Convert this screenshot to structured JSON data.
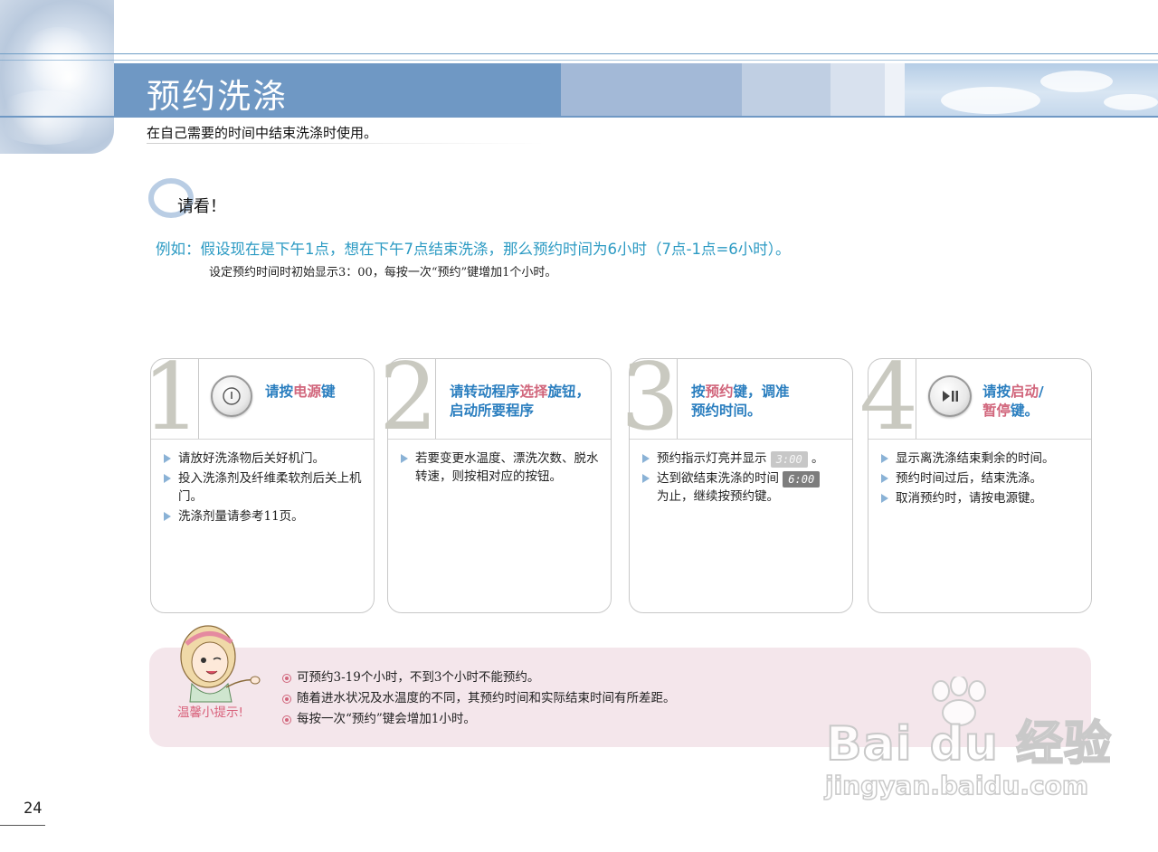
{
  "header": {
    "title": "预约洗涤",
    "subtitle": "在自己需要的时间中结束洗涤时使用。"
  },
  "note": {
    "title": "请看！",
    "example": "例如：假设现在是下午1点，想在下午7点结束洗涤，那么预约时间为6小时（7点-1点=6小时）。",
    "detail": "设定预约时间时初始显示3：00，每按一次“预约”键增加1个小时。"
  },
  "steps": [
    {
      "number": "1",
      "icon": "power-icon",
      "head": {
        "pre": "请按",
        "highlight": "电源",
        "post": "键"
      },
      "items": [
        "请放好洗涤物后关好机门。",
        "投入洗涤剂及纤维柔软剂后关上机门。",
        "洗涤剂量请参考11页。"
      ]
    },
    {
      "number": "2",
      "head": {
        "line1_pre": "请转动程序",
        "line1_highlight": "选择",
        "line1_post": "旋钮，",
        "line2": "启动所要程序"
      },
      "items": [
        "若要变更水温度、漂洗次数、脱水转速，则按相对应的按钮。"
      ]
    },
    {
      "number": "3",
      "head": {
        "line1_pre": "按",
        "line1_highlight": "预约",
        "line1_post": "键，调准",
        "line2": "预约时间。"
      },
      "items": [
        {
          "pre": "预约指示灯亮并显示",
          "lcd": "3:00",
          "post": "。"
        },
        {
          "pre": "达到欲结束洗涤的时间",
          "lcd": "6:00",
          "post": "为止，继续按预约键。"
        }
      ]
    },
    {
      "number": "4",
      "icon": "play-pause-icon",
      "head": {
        "line1_pre": "请按",
        "line1_highlight": "启动",
        "line1_post": "/",
        "line2_highlight": "暂停",
        "line2_post": "键。"
      },
      "items": [
        "显示离洗涤结束剩余的时间。",
        "预约时间过后，结束洗涤。",
        "取消预约时，请按电源键。"
      ]
    }
  ],
  "tips": {
    "label": "温馨小提示!",
    "items": [
      "可预约3-19个小时，不到3个小时不能预约。",
      "随着进水状况及水温度的不同，其预约时间和实际结束时间有所差距。",
      "每按一次“预约”键会增加1小时。"
    ]
  },
  "watermark": {
    "brand": "Bai du 经验",
    "url": "jingyan.baidu.com"
  },
  "page_number": "24",
  "colors": {
    "title_band": "#6f98c4",
    "accent_blue": "#2b9ac3",
    "highlight_pink": "#d1667c",
    "tips_bg": "#f4e6eb"
  }
}
